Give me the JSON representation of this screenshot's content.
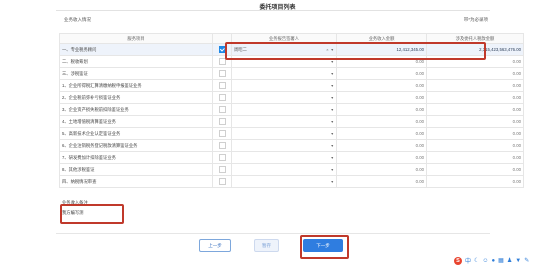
{
  "window": {
    "title": "委托项目列表"
  },
  "section": {
    "title": "业务收入情况",
    "required_note": "带*为必录项"
  },
  "table": {
    "headers": [
      "服务项目",
      "",
      "业务报告签署人",
      "业务收入金额",
      "涉及委托人税款金额"
    ],
    "rows": [
      {
        "name": "一、专业税务顾问",
        "checked": true,
        "agent": "周昭二",
        "agent_clear": "×",
        "revenue": "12,412,345.00",
        "tax": "2,315,423,563,476.00"
      },
      {
        "name": "二、税收筹划",
        "checked": false,
        "agent": "",
        "revenue": "0.00",
        "tax": "0.00"
      },
      {
        "name": "三、涉税鉴证",
        "checked": false,
        "agent": "",
        "revenue": "0.00",
        "tax": "0.00"
      },
      {
        "name": "1、企业所得税汇算清缴纳税申报鉴证业务",
        "checked": false,
        "agent": "",
        "revenue": "0.00",
        "tax": "0.00"
      },
      {
        "name": "2、企业税前弥补亏损鉴证业务",
        "checked": false,
        "agent": "",
        "revenue": "0.00",
        "tax": "0.00"
      },
      {
        "name": "3、企业资产损失税前扣除鉴证业务",
        "checked": false,
        "agent": "",
        "revenue": "0.00",
        "tax": "0.00"
      },
      {
        "name": "4、土地增值税清算鉴证业务",
        "checked": false,
        "agent": "",
        "revenue": "0.00",
        "tax": "0.00"
      },
      {
        "name": "5、高新技术企业认定鉴证业务",
        "checked": false,
        "agent": "",
        "revenue": "0.00",
        "tax": "0.00"
      },
      {
        "name": "6、企业注销税务登记税款清算鉴证业务",
        "checked": false,
        "agent": "",
        "revenue": "0.00",
        "tax": "0.00"
      },
      {
        "name": "7、研发费加计扣除鉴证业务",
        "checked": false,
        "agent": "",
        "revenue": "0.00",
        "tax": "0.00"
      },
      {
        "name": "8、其他涉税鉴证",
        "checked": false,
        "agent": "",
        "revenue": "0.00",
        "tax": "0.00"
      },
      {
        "name": "四、纳税情况审查",
        "checked": false,
        "agent": "",
        "revenue": "0.00",
        "tax": "0.00"
      }
    ]
  },
  "remarks": {
    "label": "业务收入备注",
    "value": "我方编写测"
  },
  "buttons": {
    "prev": "上一步",
    "save": "暂存",
    "next": "下一步"
  },
  "tray": {
    "logo": "S",
    "lang": "中",
    "icons": [
      "moon-icon",
      "smile-icon",
      "mic-icon",
      "keyboard-icon",
      "user-icon",
      "shirt-icon",
      "wrench-icon"
    ]
  },
  "colors": {
    "primary": "#2f7de0",
    "highlight": "#c0392b",
    "selected_row": "#eef3fb"
  }
}
